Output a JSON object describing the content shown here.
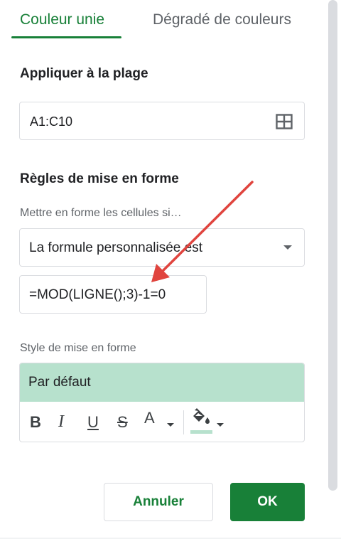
{
  "tabs": {
    "solid": "Couleur unie",
    "gradient": "Dégradé de couleurs"
  },
  "range": {
    "title": "Appliquer à la plage",
    "value": "A1:C10",
    "icon": "select-range-grid-icon"
  },
  "rules": {
    "title": "Règles de mise en forme",
    "condition_label": "Mettre en forme les cellules si…",
    "condition_value": "La formule personnalisée est",
    "formula": "=MOD(LIGNE();3)-1=0"
  },
  "style": {
    "label": "Style de mise en forme",
    "preview_text": "Par défaut",
    "fill_color": "#b7e1cd",
    "toolbar": {
      "bold": "B",
      "italic": "I",
      "underline": "U",
      "strike": "S",
      "text_color": "A"
    }
  },
  "buttons": {
    "cancel": "Annuler",
    "ok": "OK"
  },
  "colors": {
    "accent": "#188038",
    "annotation_arrow": "#e0443e"
  }
}
